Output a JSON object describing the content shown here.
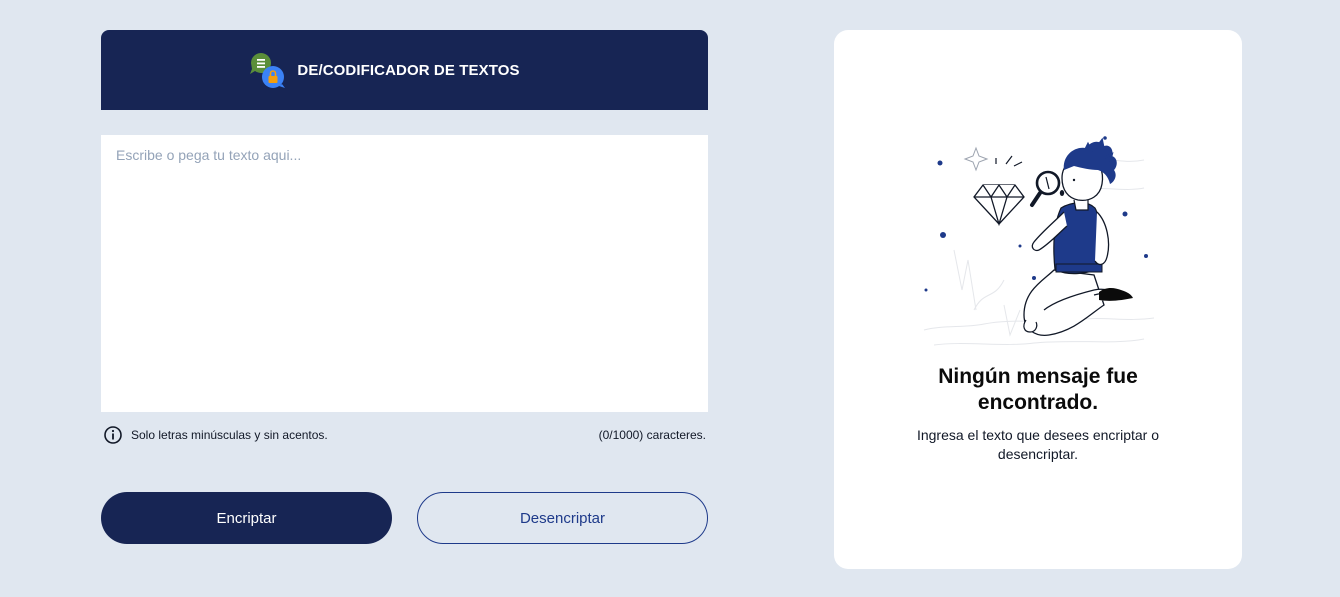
{
  "header": {
    "title": "DE/CODIFICADOR DE TEXTOS",
    "logo_icon": "chat-lock-icon"
  },
  "input": {
    "placeholder": "Escribe o pega tu texto aqui...",
    "value": ""
  },
  "hint": {
    "icon": "info-icon",
    "text": "Solo letras minúsculas y sin acentos.",
    "counter": "(0/1000) caracteres."
  },
  "buttons": {
    "encrypt_label": "Encriptar",
    "decrypt_label": "Desencriptar"
  },
  "result": {
    "illustration": "person-with-magnifying-glass-illustration",
    "title": "Ningún mensaje fue encontrado.",
    "description": "Ingresa el texto que desees encriptar o desencriptar."
  },
  "colors": {
    "background": "#e0e7f0",
    "primary": "#172554",
    "accent_border": "#1e3a8a",
    "panel": "#ffffff"
  }
}
